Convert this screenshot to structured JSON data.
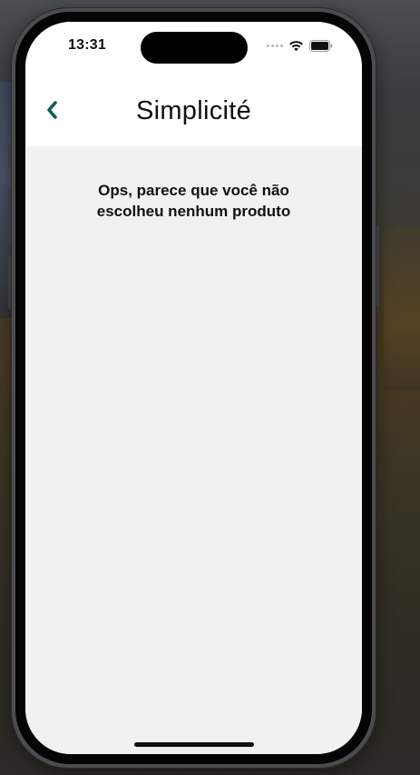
{
  "status_bar": {
    "time": "13:31",
    "icons": [
      "signal-dots-icon",
      "wifi-icon",
      "battery-icon"
    ]
  },
  "nav": {
    "back_icon": "chevron-left-icon",
    "title": "Simplicité",
    "accent_color": "#0f5c57"
  },
  "main": {
    "empty_message": "Ops, parece que você não escolheu nenhum produto"
  }
}
